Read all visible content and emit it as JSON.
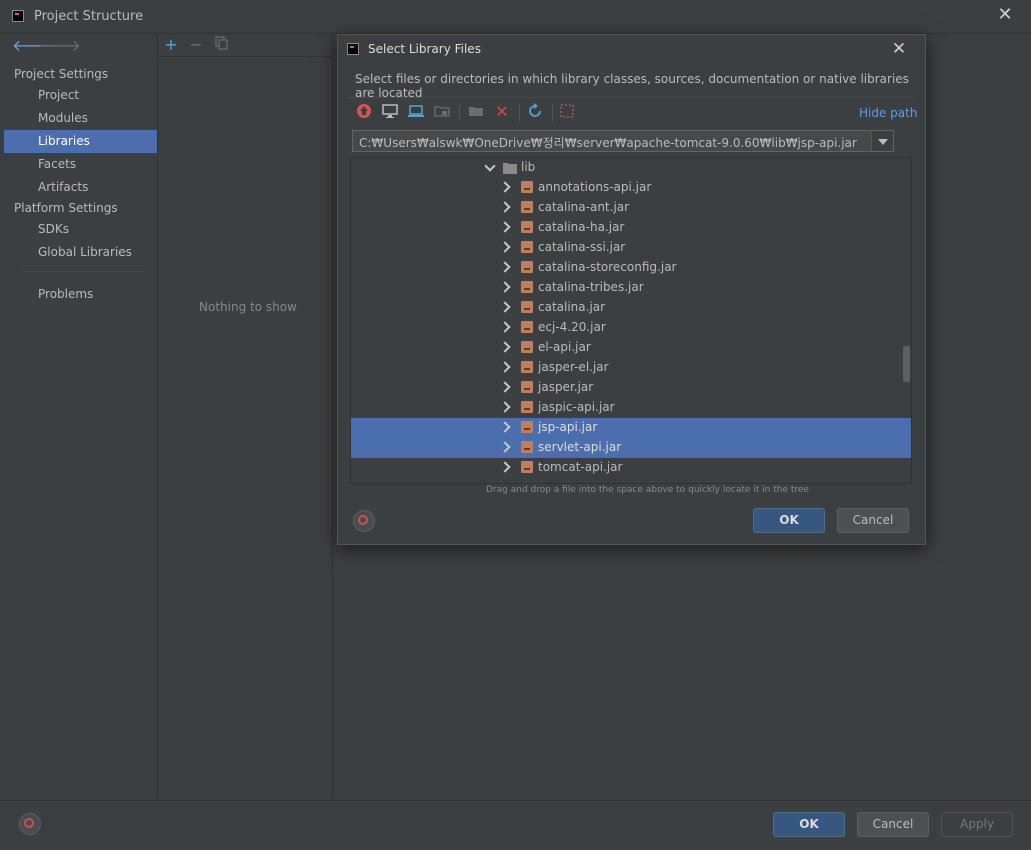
{
  "window": {
    "title": "Project Structure"
  },
  "nav": {
    "project_settings_label": "Project Settings",
    "items_top": [
      {
        "label": "Project"
      },
      {
        "label": "Modules"
      },
      {
        "label": "Libraries",
        "selected": true
      },
      {
        "label": "Facets"
      },
      {
        "label": "Artifacts"
      }
    ],
    "platform_settings_label": "Platform Settings",
    "items_platform": [
      {
        "label": "SDKs"
      },
      {
        "label": "Global Libraries"
      }
    ],
    "problems_label": "Problems"
  },
  "middle": {
    "empty_text": "Nothing to show"
  },
  "bottom": {
    "ok_label": "OK",
    "cancel_label": "Cancel",
    "apply_label": "Apply"
  },
  "dialog": {
    "title": "Select Library Files",
    "description": "Select files or directories in which library classes, sources, documentation or native libraries are located",
    "hide_path_label": "Hide path",
    "path_value": "C:₩Users₩alswk₩OneDrive₩정리₩server₩apache-tomcat-9.0.60₩lib₩jsp-api.jar",
    "tree": {
      "folder": "lib",
      "files": [
        {
          "name": "annotations-api.jar",
          "selected": false
        },
        {
          "name": "catalina-ant.jar",
          "selected": false
        },
        {
          "name": "catalina-ha.jar",
          "selected": false
        },
        {
          "name": "catalina-ssi.jar",
          "selected": false
        },
        {
          "name": "catalina-storeconfig.jar",
          "selected": false
        },
        {
          "name": "catalina-tribes.jar",
          "selected": false
        },
        {
          "name": "catalina.jar",
          "selected": false
        },
        {
          "name": "ecj-4.20.jar",
          "selected": false
        },
        {
          "name": "el-api.jar",
          "selected": false
        },
        {
          "name": "jasper-el.jar",
          "selected": false
        },
        {
          "name": "jasper.jar",
          "selected": false
        },
        {
          "name": "jaspic-api.jar",
          "selected": false
        },
        {
          "name": "jsp-api.jar",
          "selected": true
        },
        {
          "name": "servlet-api.jar",
          "selected": true
        },
        {
          "name": "tomcat-api.jar",
          "selected": false
        }
      ]
    },
    "drag_hint": "Drag and drop a file into the space above to quickly locate it in the tree",
    "ok_label": "OK",
    "cancel_label": "Cancel"
  },
  "colors": {
    "selection": "#4b6eaf",
    "primary_button": "#365880",
    "link": "#589df6"
  }
}
